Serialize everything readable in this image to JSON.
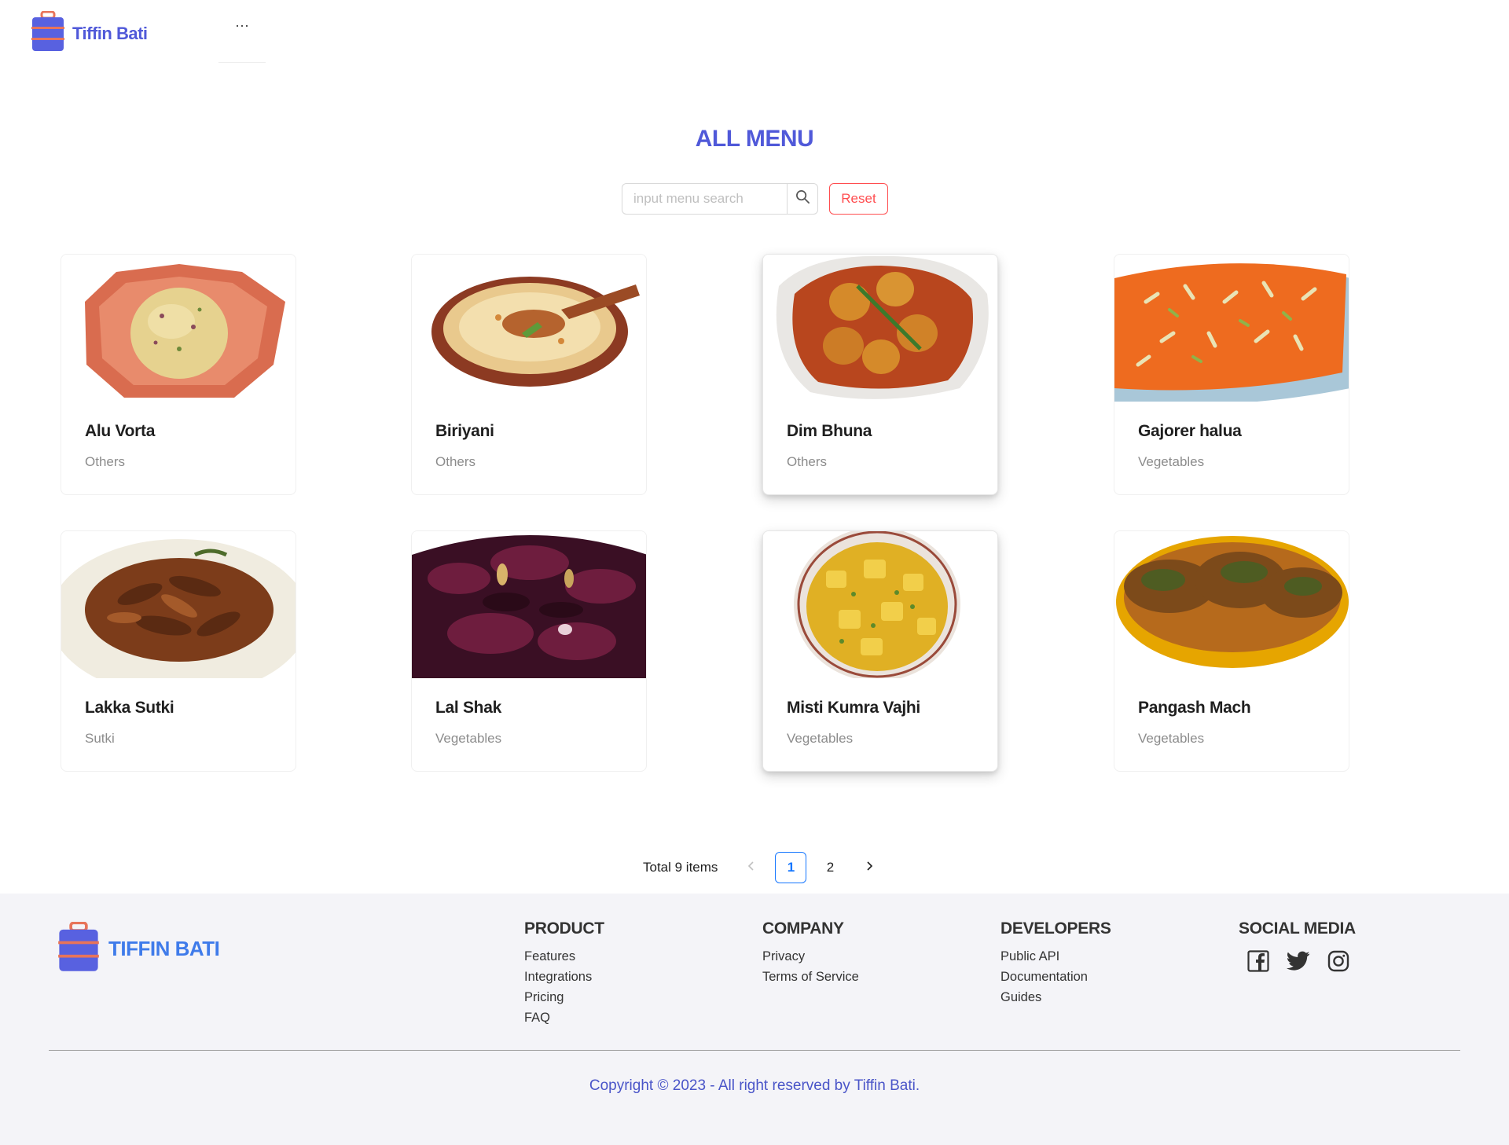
{
  "header": {
    "brand": "Tiffin Bati",
    "more": "···"
  },
  "page": {
    "title": "ALL MENU"
  },
  "search": {
    "placeholder": "input menu search",
    "reset_label": "Reset"
  },
  "menu_items": [
    {
      "name": "Alu Vorta",
      "category": "Others",
      "image": "alu-vorta-photo"
    },
    {
      "name": "Biriyani",
      "category": "Others",
      "image": "biriyani-photo"
    },
    {
      "name": "Dim Bhuna",
      "category": "Others",
      "image": "dim-bhuna-photo"
    },
    {
      "name": "Gajorer halua",
      "category": "Vegetables",
      "image": "gajorer-halua-photo"
    },
    {
      "name": "Lakka Sutki",
      "category": "Sutki",
      "image": "lakka-sutki-photo"
    },
    {
      "name": "Lal Shak",
      "category": "Vegetables",
      "image": "lal-shak-photo"
    },
    {
      "name": "Misti Kumra Vajhi",
      "category": "Vegetables",
      "image": "misti-kumra-vajhi-photo"
    },
    {
      "name": "Pangash Mach",
      "category": "Vegetables",
      "image": "pangash-mach-photo"
    }
  ],
  "pagination": {
    "total": "Total 9 items",
    "prev": "<",
    "next": ">",
    "pages": [
      "1",
      "2"
    ],
    "current": "1"
  },
  "footer": {
    "brand": "TIFFIN BATI",
    "product": {
      "heading": "PRODUCT",
      "links": [
        "Features",
        "Integrations",
        "Pricing",
        "FAQ"
      ]
    },
    "company": {
      "heading": "COMPANY",
      "links": [
        "Privacy",
        "Terms of Service"
      ]
    },
    "developers": {
      "heading": "DEVELOPERS",
      "links": [
        "Public API",
        "Documentation",
        "Guides"
      ]
    },
    "social": {
      "heading": "SOCIAL MEDIA",
      "icons": [
        "facebook-icon",
        "twitter-icon",
        "instagram-icon"
      ]
    },
    "copyright": "Copyright © 2023 - All right reserved by Tiffin Bati."
  },
  "colors": {
    "brand": "#5059d9",
    "footer_brand": "#3f7bea",
    "reset": "#ff4d4f",
    "active_page": "#1677ff",
    "footer_bg": "#f4f4f8"
  }
}
